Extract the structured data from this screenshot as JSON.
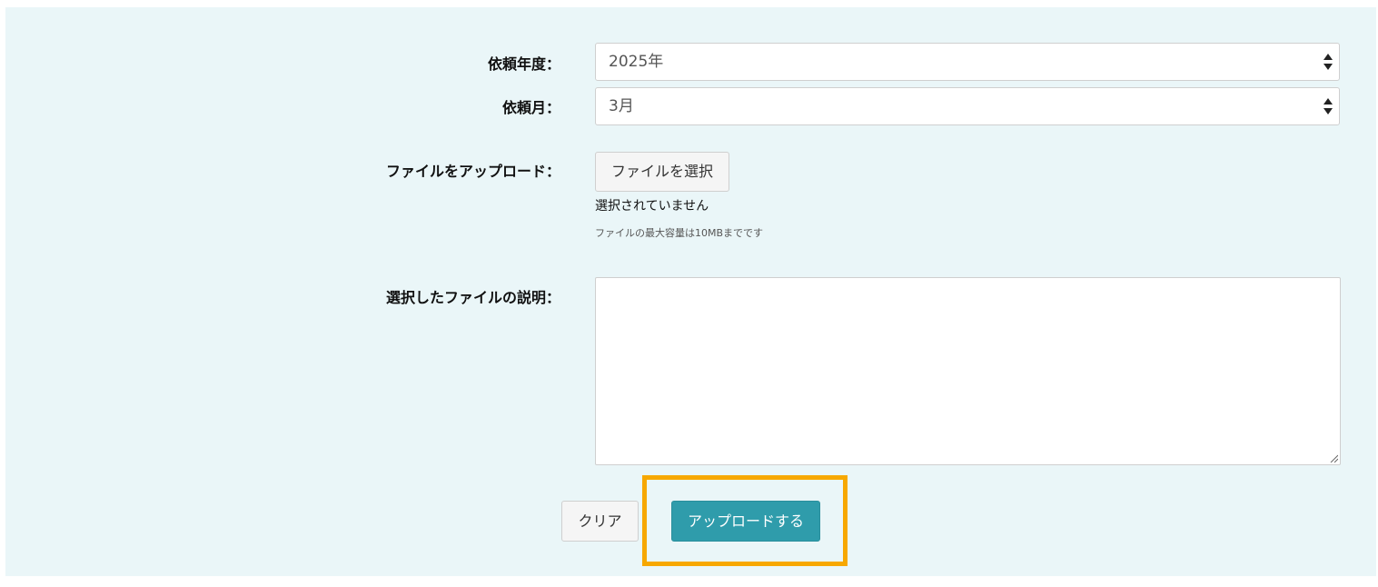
{
  "form": {
    "year": {
      "label": "依頼年度：",
      "selected": "2025年"
    },
    "month": {
      "label": "依頼月：",
      "selected": "3月"
    },
    "upload": {
      "label": "ファイルをアップロード：",
      "button_label": "ファイルを選択",
      "status": "選択されていません",
      "hint": "ファイルの最大容量は10MBまでです"
    },
    "description": {
      "label": "選択したファイルの説明：",
      "value": ""
    }
  },
  "actions": {
    "clear_label": "クリア",
    "upload_label": "アップロードする"
  },
  "colors": {
    "panel_bg": "#eaf6f8",
    "primary_button": "#2f9cab",
    "highlight": "#f7a800"
  }
}
